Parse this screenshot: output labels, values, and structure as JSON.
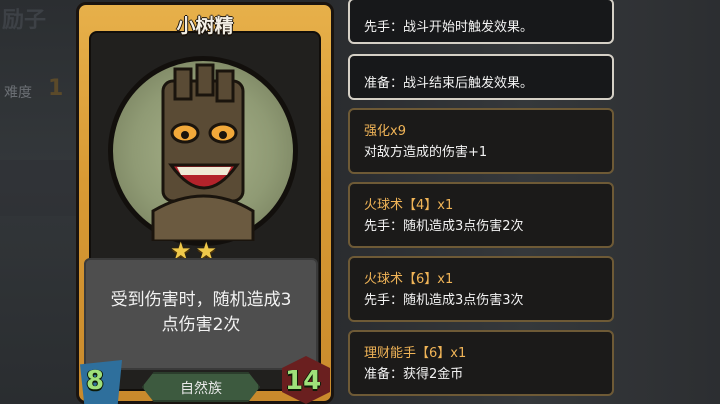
{
  "background": {
    "title_partial": "励子",
    "difficulty_label": "难度",
    "difficulty_value": "1"
  },
  "card": {
    "name": "小树精",
    "stars": 2,
    "description": "受到伤害时，随机造成3点伤害2次",
    "attack": "8",
    "health": "14",
    "tribe": "自然族"
  },
  "panels": [
    {
      "type": "keyword",
      "text": "先手：战斗开始时触发效果。"
    },
    {
      "type": "keyword",
      "text": "准备：战斗结束后触发效果。"
    },
    {
      "type": "buff",
      "head": "强化x9",
      "text": "对敌方造成的伤害+1"
    },
    {
      "type": "skill",
      "head": "火球术【4】x1",
      "text": "先手：随机造成3点伤害2次"
    },
    {
      "type": "skill",
      "head": "火球术【6】x1",
      "text": "先手：随机造成3点伤害3次"
    },
    {
      "type": "skill",
      "head": "理财能手【6】x1",
      "text": "准备：获得2金币"
    }
  ]
}
